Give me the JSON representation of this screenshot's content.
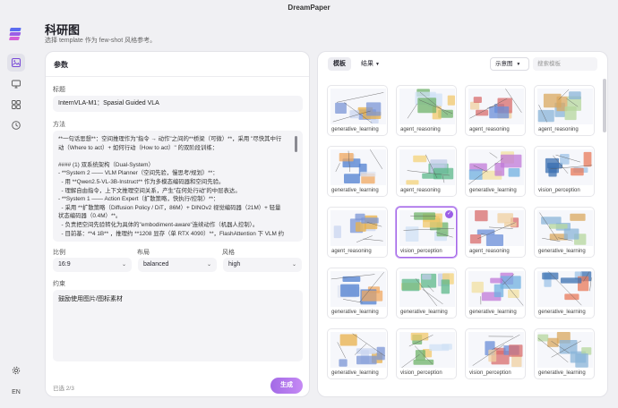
{
  "app_title": "DreamPaper",
  "header": {
    "title": "科研图",
    "subtitle": "选择 template 作为 few-shot 风格参考。"
  },
  "rail": {
    "lang": "EN"
  },
  "params": {
    "heading": "参数",
    "title_label": "标题",
    "title_value": "InternVLA-M1：Spasial Guided VLA",
    "method_label": "方法",
    "method_lines": [
      "**一句话思想**：空间推理作为\"指令 → 动作\"之间的**桥梁（可微）**，采用 \"尽快其中行",
      "动（Where to act）+ 如何行动（How to act）\" 的双阶段训练：",
      "",
      "#### (1) 双系统架构（Dual-System）",
      "- **System 2 —— VLM Planner（空间先验，慢思考/规划）**：",
      "  - 用 **Qwen2.5-VL-3B-Instruct** 作为多模态编码器和空间先验。",
      "  - 理解自由指令，上下文推理空间关系，产生\"在何处行动\"的中层表达。",
      "- **System 1 —— Action Expert（扩散策略，快执行/控制）**：",
      "  - 采用 **扩散策略（Diffusion Policy / DiT，86M）+ DINOv2 视觉编码器（21M）+ 轻量",
      "状态编码器（0.4M）**。",
      "  - 负责把空间先验转化为具体的\"embodiment-aware\"连续动作（机器人控制）。",
      "  - 目前基：**4 1B** ，推理约 **1208 显存（单 RTX 4090）**，FlashAttention 下 VLM 约"
    ],
    "ratio_label": "比例",
    "ratio_value": "16:9",
    "layout_label": "布局",
    "layout_value": "balanced",
    "style_label": "风格",
    "style_value": "high",
    "constraint_label": "约束",
    "constraint_value": "鼓励使用图片/图标素材",
    "status": "已选 2/3",
    "generate_label": "生成"
  },
  "gallery": {
    "tab_template": "模板",
    "tab_results": "结果",
    "sort_value": "示意图",
    "search_placeholder": "搜索模板",
    "cards": [
      {
        "caption": "generative_learning",
        "selected": false
      },
      {
        "caption": "agent_reasoning",
        "selected": false
      },
      {
        "caption": "agent_reasoning",
        "selected": false
      },
      {
        "caption": "agent_reasoning",
        "selected": false
      },
      {
        "caption": "generative_learning",
        "selected": false
      },
      {
        "caption": "agent_reasoning",
        "selected": false
      },
      {
        "caption": "generative_learning",
        "selected": false
      },
      {
        "caption": "vision_perception",
        "selected": false
      },
      {
        "caption": "agent_reasoning",
        "selected": false
      },
      {
        "caption": "vision_perception",
        "selected": true
      },
      {
        "caption": "agent_reasoning",
        "selected": false
      },
      {
        "caption": "generative_learning",
        "selected": false
      },
      {
        "caption": "generative_learning",
        "selected": false
      },
      {
        "caption": "generative_learning",
        "selected": false
      },
      {
        "caption": "generative_learning",
        "selected": false
      },
      {
        "caption": "generative_learning",
        "selected": false
      },
      {
        "caption": "generative_learning",
        "selected": false
      },
      {
        "caption": "vision_perception",
        "selected": false
      },
      {
        "caption": "vision_perception",
        "selected": false
      },
      {
        "caption": "generative_learning",
        "selected": false
      }
    ]
  }
}
